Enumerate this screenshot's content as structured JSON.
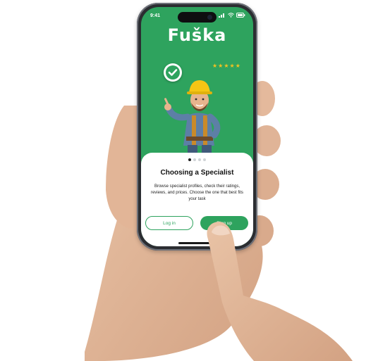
{
  "status_bar": {
    "time": "9:41"
  },
  "app": {
    "brand": "Fuška"
  },
  "onboarding": {
    "title": "Choosing a Specialist",
    "description": "Browse specialist profiles, check their ratings, reviews, and prices. Choose the one that best fits your task",
    "active_page": 1,
    "page_count": 4
  },
  "buttons": {
    "login": "Log in",
    "signup": "Sing up"
  },
  "rating": {
    "stars": 5
  },
  "colors": {
    "brand_green": "#2ea35e",
    "star": "#f2c221"
  }
}
